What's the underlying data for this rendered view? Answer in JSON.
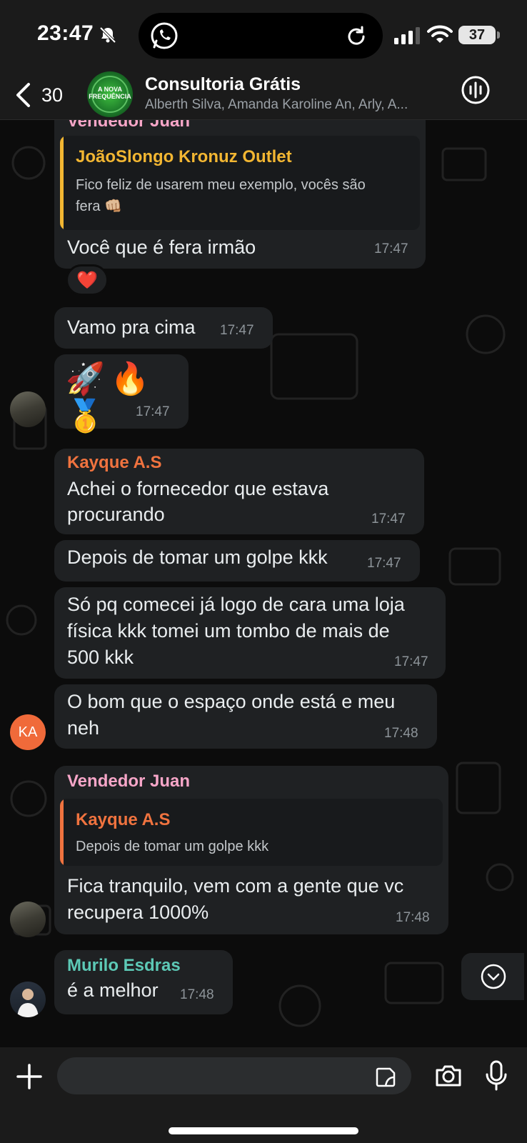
{
  "status_bar": {
    "time": "23:47",
    "battery": "37"
  },
  "header": {
    "back_count": "30",
    "group_avatar_text_1": "A NOVA",
    "group_avatar_text_2": "FREQUÊNCIA",
    "title": "Consultoria Grátis",
    "members": "Alberth Silva, Amanda Karoline An, Arly, A..."
  },
  "messages": [
    {
      "sender": "Vendedor Juan",
      "quote_name": "JoãoSlongo  Kronuz Outlet",
      "quote_text_1": "Fico feliz de usarem meu exemplo, vocês são",
      "quote_text_2": "fera 👊🏼",
      "text": "Você que é fera irmão",
      "time": "17:47",
      "reaction": "❤️"
    },
    {
      "text": "Vamo pra cima",
      "time": "17:47"
    },
    {
      "emojis": "🚀🔥🥇",
      "time": "17:47"
    },
    {
      "sender": "Kayque A.S",
      "text_1": "Achei o fornecedor que estava",
      "text_2": "procurando",
      "time": "17:47"
    },
    {
      "text": "Depois de tomar um golpe kkk",
      "time": "17:47"
    },
    {
      "text_1": "Só pq comecei já logo de cara uma loja",
      "text_2": "física kkk tomei um tombo de mais de",
      "text_3": "500 kkk",
      "time": "17:47"
    },
    {
      "text_1": "O bom que o espaço onde está e meu",
      "text_2": "neh",
      "time": "17:48",
      "avatar_initials": "KA"
    },
    {
      "sender": "Vendedor Juan",
      "quote_name": "Kayque A.S",
      "quote_text": "Depois de tomar um golpe kkk",
      "text_1": "Fica tranquilo, vem com a gente que vc",
      "text_2": "recupera 1000%",
      "time": "17:48"
    },
    {
      "sender": "Murilo Esdras",
      "text": "é a melhor",
      "time": "17:48"
    }
  ],
  "colors": {
    "juan": "#f7a6c8",
    "joao": "#f2b632",
    "kayque": "#f0733f",
    "murilo": "#5dc9b6"
  }
}
